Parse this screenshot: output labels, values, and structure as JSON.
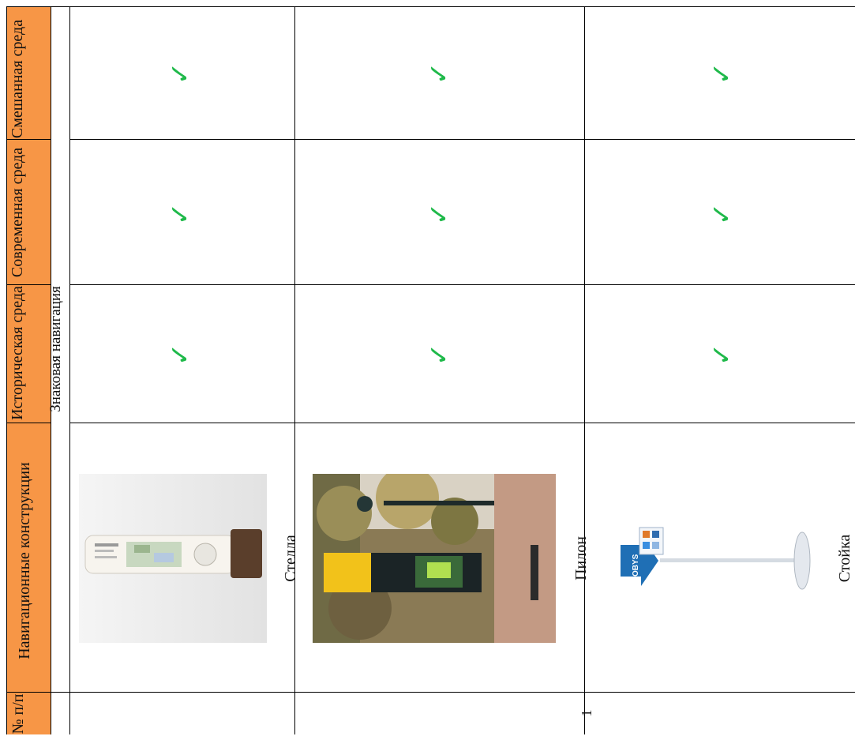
{
  "header": {
    "num": "№ п/п",
    "constructions": "Навигационные конструкции",
    "historic": "Историческая среда",
    "modern": "Современная среда",
    "mixed": "Смешанная среда"
  },
  "section_title": "Знаковая навигация",
  "rows": [
    {
      "name": "Стелла",
      "num": "",
      "historic": "✓",
      "modern": "✓",
      "mixed": "✓"
    },
    {
      "name": "Пилон",
      "num": "",
      "historic": "✓",
      "modern": "✓",
      "mixed": "✓"
    },
    {
      "name": "Стойка",
      "num": "1",
      "historic": "✓",
      "modern": "✓",
      "mixed": "✓"
    }
  ],
  "logo_text": "MOBYS",
  "colors": {
    "header_bg": "#f79646",
    "check": "#1fb94a"
  }
}
